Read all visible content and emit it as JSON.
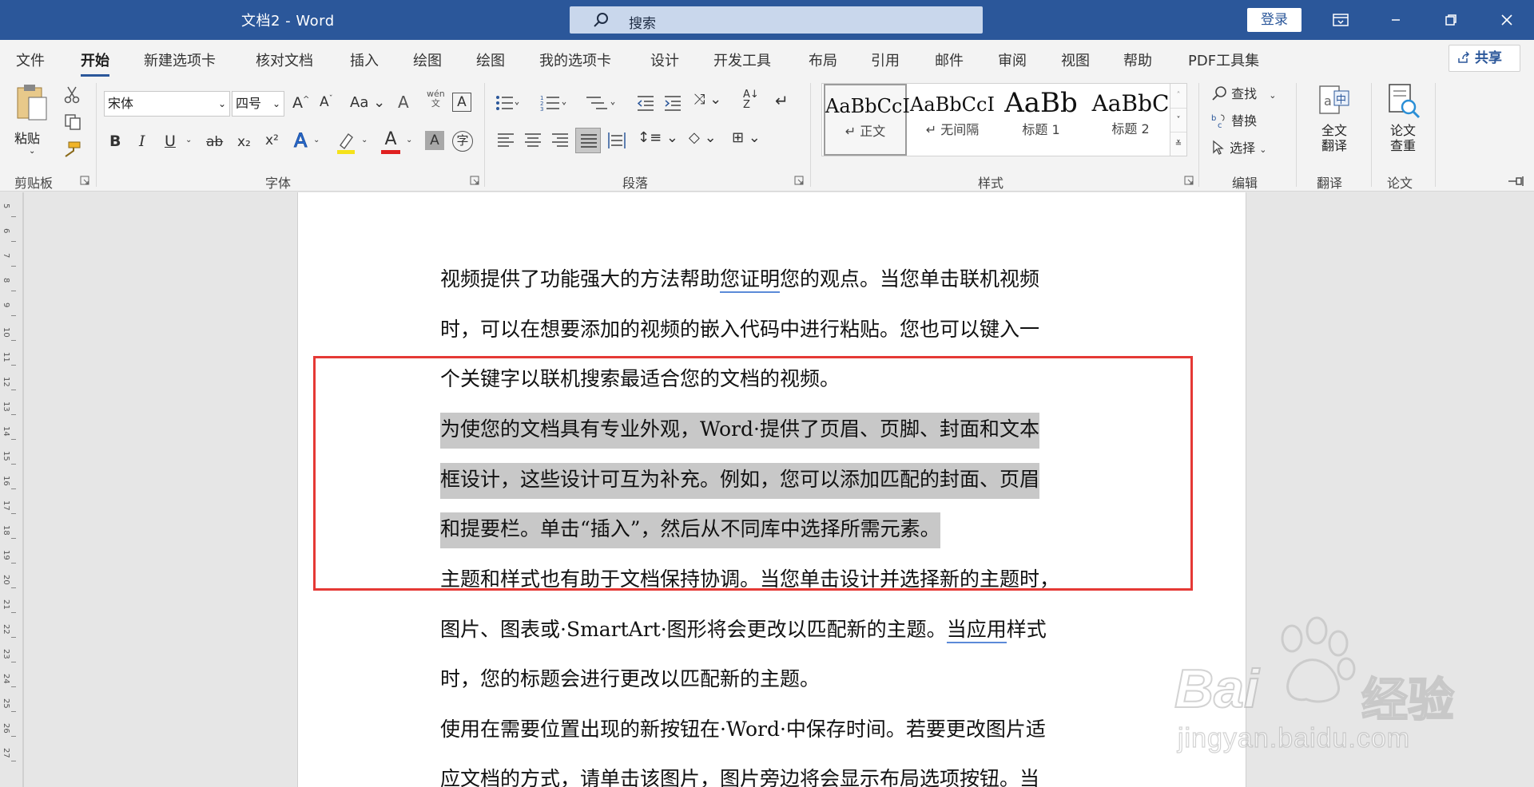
{
  "window": {
    "title": "文档2 - Word",
    "search_placeholder": "搜索",
    "login_label": "登录"
  },
  "tabs": [
    "文件",
    "开始",
    "新建选项卡",
    "核对文档",
    "插入",
    "绘图",
    "绘图",
    "我的选项卡",
    "设计",
    "开发工具",
    "布局",
    "引用",
    "邮件",
    "审阅",
    "视图",
    "帮助",
    "PDF工具集"
  ],
  "share_label": "共享",
  "ribbon": {
    "clipboard": {
      "paste": "粘贴",
      "group": "剪贴板"
    },
    "font": {
      "name": "宋体",
      "size": "四号",
      "group": "字体",
      "bold": "B",
      "italic": "I",
      "underline": "U",
      "strike": "ab",
      "subscript": "x₂",
      "superscript": "x²"
    },
    "paragraph": {
      "group": "段落"
    },
    "styles": {
      "group": "样式",
      "items": [
        {
          "preview": "AaBbCcI",
          "name": "↵ 正文"
        },
        {
          "preview": "AaBbCcI",
          "name": "↵ 无间隔"
        },
        {
          "preview": "AaBb",
          "name": "标题 1"
        },
        {
          "preview": "AaBbC",
          "name": "标题 2"
        }
      ]
    },
    "editing": {
      "find": "查找",
      "replace": "替换",
      "select": "选择",
      "group": "编辑"
    },
    "translate": {
      "label1": "全文",
      "label2": "翻译",
      "group": "翻译"
    },
    "paper": {
      "label1": "论文",
      "label2": "查重",
      "group": "论文"
    }
  },
  "document": {
    "lines": [
      {
        "parts": [
          {
            "t": "视频提供了功能强大的方法帮助"
          },
          {
            "t": "您证明",
            "u": true
          },
          {
            "t": "您的观点。当您单击联机视频"
          }
        ]
      },
      {
        "parts": [
          {
            "t": "时，可以在想要添加的视频的嵌入代码中进行粘贴。您也可以键入一"
          }
        ]
      },
      {
        "parts": [
          {
            "t": "个关键字以联机搜索最适合您的文档的视频。"
          }
        ]
      },
      {
        "parts": [
          {
            "t": "为使您的文档具有专业外观，Word·提供了页眉、页脚、封面和文本",
            "h": true
          }
        ]
      },
      {
        "parts": [
          {
            "t": "框设计，这些设计可互为补充。例如，您可以添加匹配的封面、页眉",
            "h": true
          }
        ]
      },
      {
        "parts": [
          {
            "t": "和提要栏。单击“插入”，然后从不同库中选择所需元素。",
            "h": true
          }
        ]
      },
      {
        "parts": [
          {
            "t": "主题和样式也有助于文档保持协调。当您单击设计并选择新的主题时，"
          }
        ]
      },
      {
        "parts": [
          {
            "t": "图片、图表或·SmartArt·图形将会更改以匹配新的主题。"
          },
          {
            "t": "当应用",
            "u": true
          },
          {
            "t": "样式"
          }
        ]
      },
      {
        "parts": [
          {
            "t": "时，您的标题会进行更改以匹配新的主题。"
          }
        ]
      },
      {
        "parts": [
          {
            "t": "使用在需要位置出现的新按钮在·Word·中保存时间。若要更改图片适"
          }
        ]
      },
      {
        "parts": [
          {
            "t": "应文档的方式，请单击该图片，图片旁边将会显示布局选项按钮。当"
          }
        ]
      }
    ]
  },
  "ruler": {
    "labels": [
      "5",
      "6",
      "7",
      "8",
      "9",
      "10",
      "11",
      "12",
      "13",
      "14",
      "15",
      "16",
      "17",
      "18",
      "19",
      "20",
      "21",
      "22",
      "23",
      "24",
      "25",
      "26",
      "27"
    ]
  },
  "watermark": {
    "brand": "Bai",
    "brand2": "经验",
    "url": "jingyan.baidu.com"
  }
}
